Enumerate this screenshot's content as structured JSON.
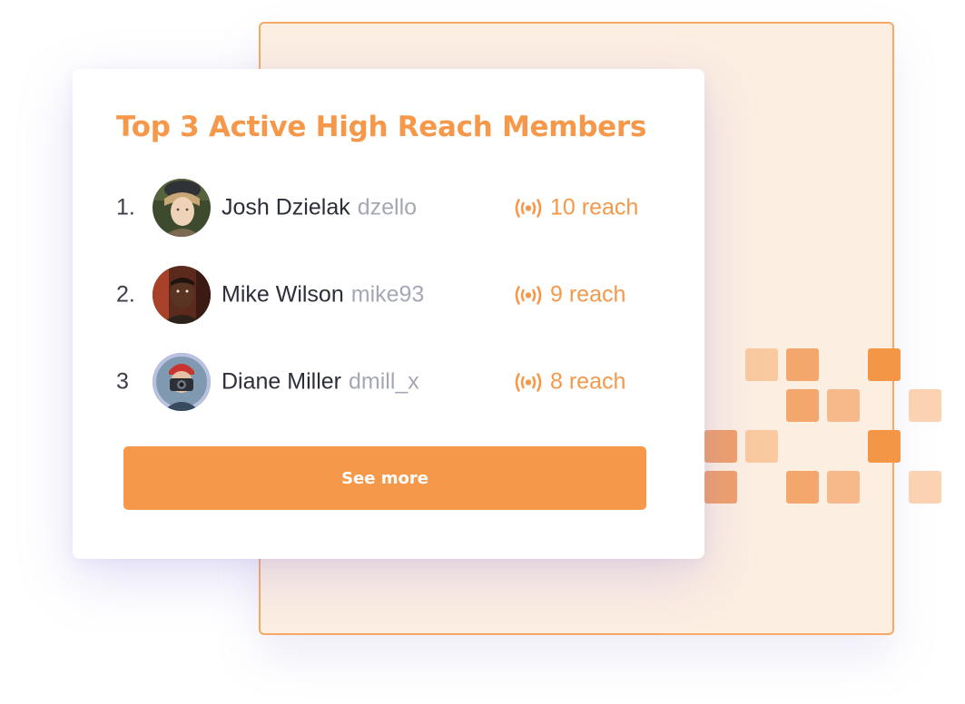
{
  "theme": {
    "accent": "#f5984a",
    "backdrop_fill": "#fdeee2",
    "backdrop_border": "#f5a965"
  },
  "card": {
    "title": "Top 3 Active High Reach Members",
    "members": [
      {
        "rank": "1.",
        "name": "Josh Dzielak",
        "handle": "dzello",
        "reach": "10 reach",
        "reach_icon": "broadcast-icon",
        "avatar": "avatar-photo"
      },
      {
        "rank": "2.",
        "name": "Mike Wilson",
        "handle": "mike93",
        "reach": "9 reach",
        "reach_icon": "broadcast-icon",
        "avatar": "avatar-photo"
      },
      {
        "rank": "3",
        "name": "Diane Miller",
        "handle": "dmill_x",
        "reach": "8 reach",
        "reach_icon": "broadcast-icon",
        "avatar": "avatar-photo"
      }
    ],
    "see_more_label": "See more"
  }
}
